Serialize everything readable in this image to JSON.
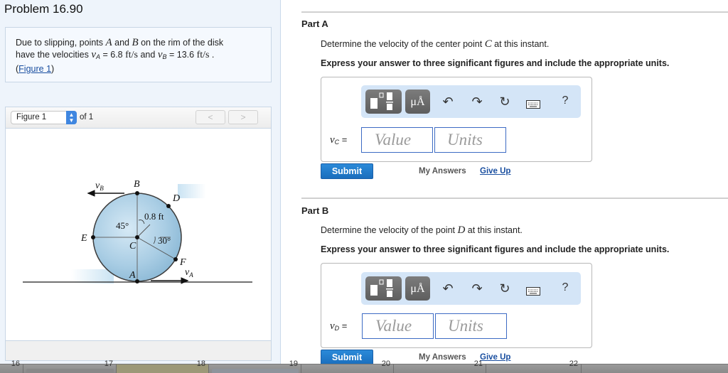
{
  "problem": {
    "title": "Problem 16.90",
    "statement": {
      "t1": "Due to slipping, points ",
      "A": "A",
      "t2": " and ",
      "B": "B",
      "t3": " on the rim of the disk",
      "t4": "have the velocities ",
      "vA_sym": "v",
      "vA_sub": "A",
      "vA_val": " = 6.8 ",
      "unit1": "ft/s",
      "t5": " and ",
      "vB_sym": "v",
      "vB_sub": "B",
      "vB_val": " = 13.6 ",
      "unit2": "ft/s",
      "t6": " .",
      "paren_open": "(",
      "figure_link": "Figure 1",
      "paren_close": ")"
    }
  },
  "figure_viewer": {
    "selected": "Figure 1",
    "of_label": "of 1",
    "prev_glyph": "<",
    "next_glyph": ">",
    "diagram": {
      "labels": {
        "vB": "v",
        "vB_sub": "B",
        "B": "B",
        "D": "D",
        "dist": "0.8 ft",
        "angle45": "45°",
        "E": "E",
        "C": "C",
        "angle30": "30°",
        "F": "F",
        "A": "A",
        "vA": "v",
        "vA_sub": "A"
      },
      "disk_color": "#a9cde4"
    }
  },
  "parts": [
    {
      "title": "Part A",
      "q_pre": "Determine the velocity of the center point ",
      "q_sym": "C",
      "q_post": " at this instant.",
      "instruction": "Express your answer to three significant figures and include the appropriate units.",
      "eq_sym": "v",
      "eq_sub": "C",
      "eq_sign": " =",
      "value_placeholder": "Value",
      "units_placeholder": "Units",
      "submit": "Submit",
      "my_answers": "My Answers",
      "give_up": "Give Up"
    },
    {
      "title": "Part B",
      "q_pre": "Determine the velocity of the point ",
      "q_sym": "D",
      "q_post": " at this instant.",
      "instruction": "Express your answer to three significant figures and include the appropriate units.",
      "eq_sym": "v",
      "eq_sub": "D",
      "eq_sign": " =",
      "value_placeholder": "Value",
      "units_placeholder": "Units",
      "submit": "Submit",
      "my_answers": "My Answers",
      "give_up": "Give Up"
    }
  ],
  "toolbar": {
    "units_btn": "μÅ",
    "undo_icon": "undo-icon",
    "redo_icon": "redo-icon",
    "reset_icon": "reset-icon",
    "keyboard_icon": "keyboard-icon",
    "help": "?"
  },
  "bottom_calendar": {
    "days": [
      "16",
      "17",
      "18",
      "19",
      "20",
      "21",
      "22"
    ]
  },
  "colors": {
    "link": "#1a4fa0",
    "submit": "#1f79c9",
    "toolbar_bg": "#d4e5f7",
    "left_panel_bg": "#eef4fb"
  }
}
